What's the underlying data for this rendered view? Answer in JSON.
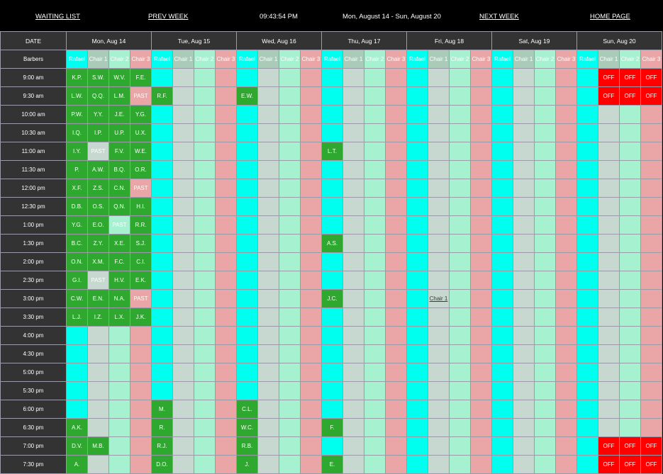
{
  "nav": {
    "waiting_list": "WAITING LIST",
    "prev_week": "PREV WEEK",
    "clock": "09:43:54 PM",
    "week_range": "Mon, August 14 - Sun, August 20",
    "next_week": "NEXT WEEK",
    "home_page": "HOME PAGE"
  },
  "labels": {
    "date": "DATE",
    "barbers": "Barbers"
  },
  "days": [
    "Mon, Aug 14",
    "Tue, Aug 15",
    "Wed, Aug 16",
    "Thu, Aug 17",
    "Fri, Aug 18",
    "Sat, Aug 19",
    "Sun, Aug 20"
  ],
  "chairs": [
    "Rafael",
    "Chair 1",
    "Chair 2",
    "Chair 3"
  ],
  "times": [
    "9:00 am",
    "9:30 am",
    "10:00 am",
    "10:30 am",
    "11:00 am",
    "11:30 am",
    "12:00 pm",
    "12:30 pm",
    "1:00 pm",
    "1:30 pm",
    "2:00 pm",
    "2:30 pm",
    "3:00 pm",
    "3:30 pm",
    "4:00 pm",
    "4:30 pm",
    "5:00 pm",
    "5:30 pm",
    "6:00 pm",
    "6:30 pm",
    "7:00 pm",
    "7:30 pm"
  ],
  "past_label": "PAST",
  "off_label": "OFF",
  "bookings": {
    "0": [
      [
        "K.P.",
        "S.W.",
        "W.V.",
        "F.E."
      ],
      [
        "L.W.",
        "Q.Q.",
        "L.M.",
        "@past"
      ],
      [
        "P.W.",
        "Y.Y.",
        "J.E.",
        "Y.G."
      ],
      [
        "I.Q.",
        "I.P.",
        "U.P.",
        "U.X."
      ],
      [
        "I.Y.",
        "@past",
        "F.V.",
        "W.E."
      ],
      [
        "P.",
        "A.W.",
        "B.Q.",
        "O.R."
      ],
      [
        "X.F.",
        "Z.S.",
        "C.N.",
        "@past"
      ],
      [
        "D.B.",
        "O.S.",
        "Q.N.",
        "H.I."
      ],
      [
        "Y.G.",
        "E.O.",
        "@past",
        "R.R."
      ],
      [
        "B.C.",
        "Z.Y.",
        "X.E.",
        "S.J."
      ],
      [
        "O.N.",
        "X.M.",
        "F.C.",
        "C.I."
      ],
      [
        "G.I.",
        "@past",
        "H.V.",
        "E.K."
      ],
      [
        "C.W.",
        "E.N.",
        "N.A.",
        "@past"
      ],
      [
        "L.J.",
        "I.Z.",
        "L.X.",
        "J.K."
      ],
      [
        null,
        null,
        null,
        null
      ],
      [
        null,
        null,
        null,
        null
      ],
      [
        null,
        null,
        null,
        null
      ],
      [
        null,
        null,
        null,
        null
      ],
      [
        null,
        null,
        null,
        null
      ],
      [
        "A.K.",
        null,
        null,
        null
      ],
      [
        "D.V.",
        "M.B.",
        null,
        null
      ],
      [
        "A.",
        null,
        null,
        null
      ]
    ],
    "1": {
      "1": [
        "R.F.",
        null,
        null,
        null
      ],
      "18": [
        "M.",
        null,
        null,
        null
      ],
      "19": [
        "R.",
        null,
        null,
        null
      ],
      "20": [
        "R.J.",
        null,
        null,
        null
      ],
      "21": [
        "D.O.",
        null,
        null,
        null
      ]
    },
    "2": {
      "1": [
        "E.W.",
        null,
        null,
        null
      ],
      "18": [
        "C.L.",
        null,
        null,
        null
      ],
      "19": [
        "W.C.",
        null,
        null,
        null
      ],
      "20": [
        "R.B.",
        null,
        null,
        null
      ],
      "21": [
        "J.",
        null,
        null,
        null
      ]
    },
    "3": {
      "4": [
        "L.T.",
        null,
        null,
        null
      ],
      "9": [
        "A.S.",
        null,
        null,
        null
      ],
      "12": [
        "J.C.",
        null,
        null,
        null
      ],
      "19": [
        "F.",
        null,
        null,
        null
      ],
      "21": [
        "E.",
        null,
        null,
        null
      ]
    }
  },
  "empty_rafael_days": [
    4,
    5,
    6
  ],
  "off_rows_sunday": [
    0,
    1,
    20,
    21
  ],
  "fri_underlined_row": 12,
  "colors": {
    "booked": "#2ea82e",
    "rafael": "#00ffee",
    "chair1": "#c6d8d0",
    "chair2": "#a6f2d0",
    "chair3": "#eaa6a6",
    "off": "#ff0000",
    "link_text": "#3a7ad8"
  }
}
